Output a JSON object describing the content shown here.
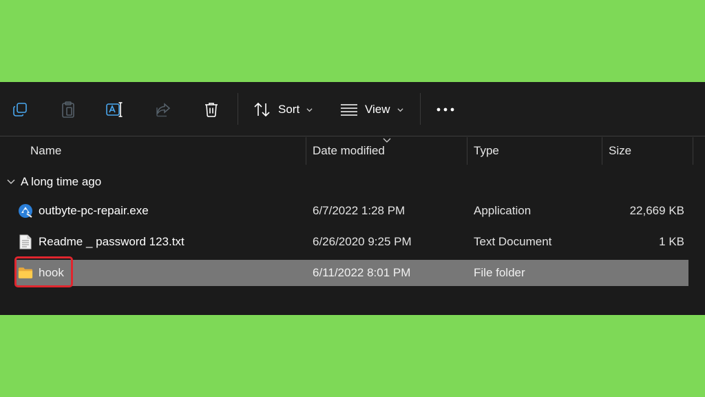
{
  "toolbar": {
    "copy_icon": "copy-icon",
    "paste_icon": "paste-icon",
    "rename_icon": "rename-icon",
    "share_icon": "share-icon",
    "delete_icon": "delete-icon",
    "sort_label": "Sort",
    "view_label": "View",
    "more_icon": "more-icon"
  },
  "columns": {
    "name": "Name",
    "date": "Date modified",
    "type": "Type",
    "size": "Size"
  },
  "group": {
    "label": "A long time ago"
  },
  "files": [
    {
      "name": "outbyte-pc-repair.exe",
      "date": "6/7/2022 1:28 PM",
      "type": "Application",
      "size": "22,669 KB",
      "icon": "app-icon",
      "selected": false
    },
    {
      "name": "Readme _ password 123.txt",
      "date": "6/26/2020 9:25 PM",
      "type": "Text Document",
      "size": "1 KB",
      "icon": "text-file-icon",
      "selected": false
    },
    {
      "name": "hook",
      "date": "6/11/2022 8:01 PM",
      "type": "File folder",
      "size": "",
      "icon": "folder-icon",
      "selected": true
    }
  ],
  "colors": {
    "background": "#7ed957",
    "explorer_bg": "#1b1b1b",
    "selected_row": "#777777",
    "highlight_border": "#e0262e"
  }
}
